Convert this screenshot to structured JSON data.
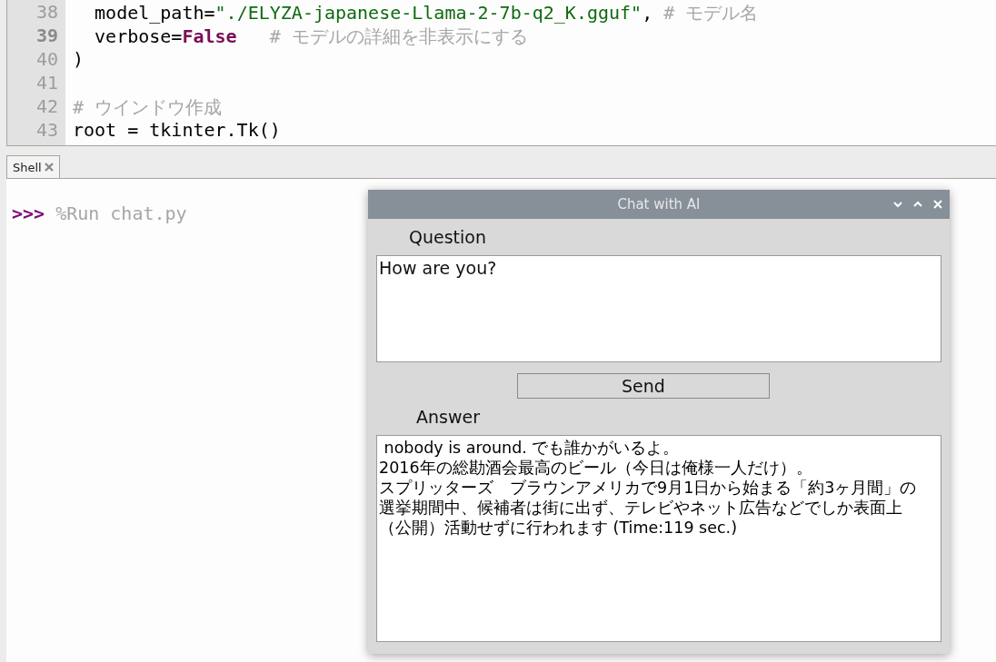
{
  "editor": {
    "lines": [
      {
        "number": "38",
        "current": false,
        "tokens": [
          {
            "kind": "plain",
            "text": "  model_path="
          },
          {
            "kind": "string",
            "text": "\"./ELYZA-japanese-Llama-2-7b-q2_K.gguf\""
          },
          {
            "kind": "plain",
            "text": ", "
          },
          {
            "kind": "comment",
            "text": "# モデル名"
          }
        ]
      },
      {
        "number": "39",
        "current": true,
        "tokens": [
          {
            "kind": "plain",
            "text": "  verbose="
          },
          {
            "kind": "keyword",
            "text": "False"
          },
          {
            "kind": "comment",
            "text": "   # モデルの詳細を非表示にする"
          }
        ]
      },
      {
        "number": "40",
        "current": false,
        "tokens": [
          {
            "kind": "plain",
            "text": ")"
          }
        ]
      },
      {
        "number": "41",
        "current": false
      },
      {
        "number": "42",
        "current": false,
        "tokens": [
          {
            "kind": "comment",
            "text": "# ウインドウ作成"
          }
        ]
      },
      {
        "number": "43",
        "current": false,
        "tokens": [
          {
            "kind": "plain",
            "text": "root = tkinter.Tk()"
          }
        ]
      }
    ]
  },
  "shell": {
    "tab": {
      "label": "Shell",
      "selected": true
    },
    "prompt": ">>>",
    "command": "%Run chat.py"
  },
  "dialog": {
    "title": "Chat with AI",
    "question_label": "Question",
    "question": "How are you?",
    "send_button": "Send",
    "answer_label": "Answer",
    "answer_lines": [
      " nobody is around. でも誰かがいるよ。",
      "2016年の総勘酒会最高のビール（今日は俺様一人だけ）。",
      "スプリッターズ　ブラウンアメリカで9月1日から始まる「約3ヶ月間」の",
      "選挙期間中、候補者は街に出ず、テレビやネット広告などでしか表面上",
      "（公開）活動せずに行われます (Time:119 sec.)"
    ]
  }
}
